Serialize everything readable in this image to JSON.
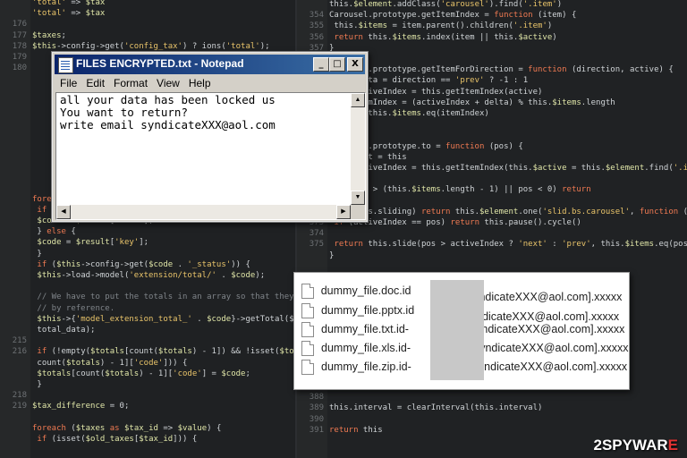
{
  "notepad": {
    "title": "FILES ENCRYPTED.txt - Notepad",
    "menu": [
      "File",
      "Edit",
      "Format",
      "View",
      "Help"
    ],
    "content": "all your data has been locked us\nYou want to return?\nwrite email syndicateXXX@aol.com",
    "controls": {
      "minimize": "_",
      "maximize": "□",
      "close": "X"
    }
  },
  "files": [
    {
      "name": "dummy_file.doc.id",
      "suffix": "A.[syndicateXXX@aol.com].xxxxx"
    },
    {
      "name": "dummy_file.pptx.id",
      "suffix": "A.[syndicateXXX@aol.com].xxxxx"
    },
    {
      "name": "dummy_file.txt.id-",
      "suffix": ".[syndicateXXX@aol.com].xxxxx"
    },
    {
      "name": "dummy_file.xls.id-",
      "suffix": ".[syndicateXXX@aol.com].xxxxx"
    },
    {
      "name": "dummy_file.zip.id-",
      "suffix": ".[syndicateXXX@aol.com].xxxxx"
    }
  ],
  "watermark": {
    "prefix": "2SPYWAR",
    "accent": "E"
  },
  "code_left": [
    {
      "n": "",
      "t": "'total' => $tax"
    },
    {
      "n": "",
      "t": "'total' => $tax"
    },
    {
      "n": "176",
      "t": ""
    },
    {
      "n": "177",
      "t": "$taxes;"
    },
    {
      "n": "178",
      "t": "$this->config->get('config_tax') ? ions('total');"
    },
    {
      "n": "179",
      "t": ""
    },
    {
      "n": "180",
      "t": ""
    },
    {
      "n": "",
      "t": ""
    },
    {
      "n": "",
      "t": ""
    },
    {
      "n": "",
      "t": ""
    },
    {
      "n": "",
      "t": ""
    },
    {
      "n": "",
      "t": ""
    },
    {
      "n": "",
      "t": ""
    },
    {
      "n": "",
      "t": ""
    },
    {
      "n": "",
      "t": ""
    },
    {
      "n": "",
      "t": ""
    },
    {
      "n": "",
      "t": ""
    },
    {
      "n": "",
      "t": ""
    },
    {
      "n": "",
      "t": "foreach ($results as $result) {"
    },
    {
      "n": "",
      "t": "  if (isset($result['code'])) {"
    },
    {
      "n": "",
      "t": "    $code = $result['code'];"
    },
    {
      "n": "",
      "t": "  } else {"
    },
    {
      "n": "",
      "t": "    $code = $result['key'];"
    },
    {
      "n": "",
      "t": "  }"
    },
    {
      "n": "",
      "t": "  if ($this->config->get($code . '_status')) {"
    },
    {
      "n": "",
      "t": "    $this->load->model('extension/total/' . $code);"
    },
    {
      "n": "",
      "t": ""
    },
    {
      "n": "",
      "t": "    // We have to put the totals in an array so that they pass"
    },
    {
      "n": "",
      "t": "    // by reference."
    },
    {
      "n": "",
      "t": "    $this->{'model_extension_total_' . $code}->getTotal($"
    },
    {
      "n": "",
      "t": "      total_data);"
    },
    {
      "n": "215",
      "t": ""
    },
    {
      "n": "216",
      "t": "    if (!empty($totals[count($totals) - 1]) && !isset($totals["
    },
    {
      "n": "",
      "t": "      count($totals) - 1]['code'])) {"
    },
    {
      "n": "",
      "t": "      $totals[count($totals) - 1]['code'] = $code;"
    },
    {
      "n": "",
      "t": "    }"
    },
    {
      "n": "218",
      "t": ""
    },
    {
      "n": "219",
      "t": "$tax_difference = 0;"
    },
    {
      "n": "",
      "t": ""
    },
    {
      "n": "",
      "t": "foreach ($taxes as $tax_id => $value) {"
    },
    {
      "n": "",
      "t": "  if (isset($old_taxes[$tax_id])) {"
    }
  ],
  "code_right": [
    {
      "n": "",
      "t": "this.$element.addClass('carousel').find('.item')"
    },
    {
      "n": "354",
      "t": "Carousel.prototype.getItemIndex = function (item) {"
    },
    {
      "n": "355",
      "t": "  this.$items = item.parent().children('.item')"
    },
    {
      "n": "356",
      "t": "  return this.$items.index(item || this.$active)"
    },
    {
      "n": "357",
      "t": "}"
    },
    {
      "n": "358",
      "t": ""
    },
    {
      "n": "",
      "t": "Carousel.prototype.getItemForDirection = function (direction, active) {"
    },
    {
      "n": "",
      "t": "  var delta = direction == 'prev' ? -1 : 1"
    },
    {
      "n": "",
      "t": "  var activeIndex = this.getItemIndex(active)"
    },
    {
      "n": "",
      "t": "  var itemIndex = (activeIndex + delta) % this.$items.length"
    },
    {
      "n": "",
      "t": "  return this.$items.eq(itemIndex)"
    },
    {
      "n": "",
      "t": "}"
    },
    {
      "n": "",
      "t": ""
    },
    {
      "n": "",
      "t": "Carousel.prototype.to = function (pos) {"
    },
    {
      "n": "",
      "t": "  var that = this"
    },
    {
      "n": "",
      "t": "  var activeIndex = this.getItemIndex(this.$active = this.$element.find('.item.active'))"
    },
    {
      "n": "",
      "t": ""
    },
    {
      "n": "",
      "t": "  if (pos > (this.$items.length - 1) || pos < 0) return"
    },
    {
      "n": "371",
      "t": ""
    },
    {
      "n": "372",
      "t": "  if (this.sliding)       return this.$element.one('slid.bs.carousel', function () { that.to(pos) })"
    },
    {
      "n": "373",
      "t": "  if (activeIndex == pos) return this.pause().cycle()"
    },
    {
      "n": "374",
      "t": ""
    },
    {
      "n": "375",
      "t": "  return this.slide(pos > activeIndex ? 'next' : 'prev', this.$items.eq(pos))"
    },
    {
      "n": "",
      "t": "}"
    },
    {
      "n": "",
      "t": ""
    },
    {
      "n": "",
      "t": ""
    },
    {
      "n": "",
      "t": ""
    },
    {
      "n": "",
      "t": ""
    },
    {
      "n": "",
      "t": ""
    },
    {
      "n": "",
      "t": ""
    },
    {
      "n": "",
      "t": ""
    },
    {
      "n": "",
      "t": ""
    },
    {
      "n": "384",
      "t": ""
    },
    {
      "n": "385",
      "t": ""
    },
    {
      "n": "386",
      "t": ""
    },
    {
      "n": "387",
      "t": "}"
    },
    {
      "n": "388",
      "t": ""
    },
    {
      "n": "389",
      "t": "this.interval = clearInterval(this.interval)"
    },
    {
      "n": "390",
      "t": ""
    },
    {
      "n": "391",
      "t": "return this"
    }
  ]
}
